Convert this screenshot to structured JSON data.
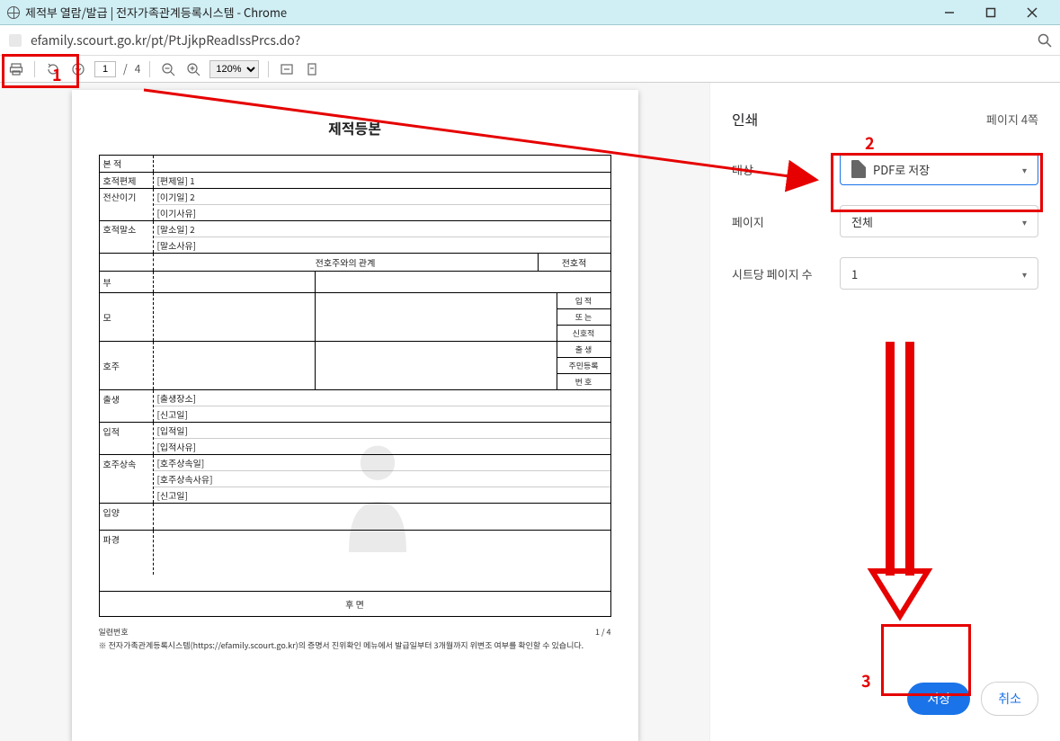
{
  "window": {
    "title": "제적부 열람/발급 | 전자가족관계등록시스템 - Chrome"
  },
  "addressbar": {
    "url": "efamily.scourt.go.kr/pt/PtJjkpReadIssPrcs.do?"
  },
  "pdf_toolbar": {
    "page_current": "1",
    "page_total": "4",
    "page_sep": "/",
    "zoom": "120%"
  },
  "document": {
    "title": "제적등본",
    "rows": {
      "bonjok": {
        "label": "본 적",
        "value": ""
      },
      "hojok_pyungye": {
        "label": "호적편제",
        "items": [
          "[편제일] 1"
        ]
      },
      "jeonsan_igi": {
        "label": "전산이기",
        "items": [
          "[이기일] 2",
          "[이기사유]"
        ]
      },
      "hojok_malso": {
        "label": "호적말소",
        "items": [
          "[말소일] 2",
          "[말소사유]"
        ]
      }
    },
    "relation_head": "전호주와의 관계",
    "relation_sidebox": "전호적",
    "relation_rows": {
      "bu": "부",
      "mo": "모",
      "hoju": "호주"
    },
    "relation_rightlabels": {
      "iljeok": "입 적",
      "ddoneun": "또 는",
      "sinhojeok": "신호적",
      "chulsaeng": "출 생",
      "jumin": "주민등록",
      "beonho": "번 호"
    },
    "events": {
      "chulsaeng": {
        "label": "출생",
        "items": [
          "[출생장소]",
          "[신고일]"
        ]
      },
      "ipjeok": {
        "label": "입적",
        "items": [
          "[입적일]",
          "[입적사유]"
        ]
      },
      "hoju_sangsok": {
        "label": "호주상속",
        "items": [
          "[호주상속일]",
          "[호주상속사유]",
          "[신고일]"
        ]
      },
      "ibyang": {
        "label": "입양",
        "items": []
      },
      "pagyeong": {
        "label": "파경",
        "items": []
      }
    },
    "footer_center": "후 면",
    "footer_left": "일련번호",
    "footer_page": "1   /   4",
    "footnote": "※ 전자가족관계등록시스템(https://efamily.scourt.go.kr)의 증명서 진위확인 메뉴에서 발급일부터 3개월까지 위변조 여부를 확인할 수 있습니다."
  },
  "print_panel": {
    "title": "인쇄",
    "page_count": "페이지 4쪽",
    "dest_label": "대상",
    "dest_value": "PDF로 저장",
    "pages_label": "페이지",
    "pages_value": "전체",
    "sheets_label": "시트당 페이지 수",
    "sheets_value": "1",
    "save": "저장",
    "cancel": "취소"
  },
  "annotations": {
    "n1": "1",
    "n2": "2",
    "n3": "3"
  }
}
